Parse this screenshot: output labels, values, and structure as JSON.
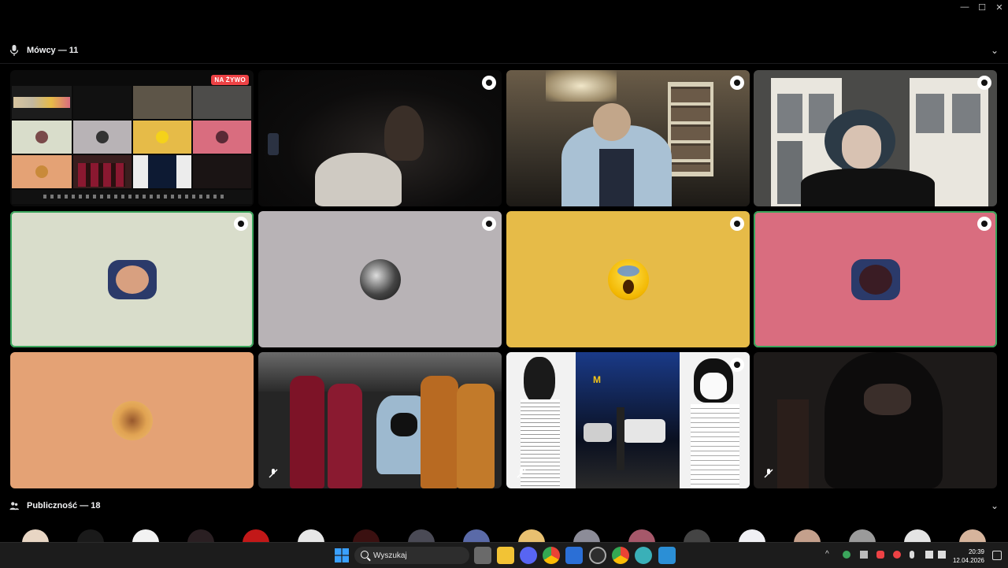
{
  "window": {
    "minimize": "—",
    "maximize": "☐",
    "close": "✕"
  },
  "speakers": {
    "label": "Mówcy — 11",
    "icon": "microphone-icon",
    "chevron": "⌄"
  },
  "audience": {
    "label": "Publiczność — 18",
    "icon": "people-icon",
    "chevron": "⌄"
  },
  "live_badge": "NA ŻYWO",
  "tiles": [
    {
      "name": "screen-share-tile",
      "kind": "stream"
    },
    {
      "name": "camera-tile-dark-room",
      "kind": "camera"
    },
    {
      "name": "camera-tile-bookshelf",
      "kind": "camera"
    },
    {
      "name": "camera-tile-window",
      "kind": "camera"
    },
    {
      "name": "avatar-tile-beige",
      "kind": "avatar",
      "bg": "#d9ddcb",
      "speaking": true
    },
    {
      "name": "avatar-tile-gray",
      "kind": "avatar",
      "bg": "#b8b3b6"
    },
    {
      "name": "avatar-tile-yellow",
      "kind": "avatar",
      "bg": "#e6bb48"
    },
    {
      "name": "avatar-tile-pink",
      "kind": "avatar",
      "bg": "#d96d7f",
      "speaking": true
    },
    {
      "name": "avatar-tile-orange",
      "kind": "avatar",
      "bg": "#e4a275"
    },
    {
      "name": "camera-tile-bottles",
      "kind": "camera"
    },
    {
      "name": "camera-tile-manga",
      "kind": "camera"
    },
    {
      "name": "camera-tile-masked",
      "kind": "camera"
    }
  ],
  "taskbar": {
    "search_placeholder": "Wyszukaj",
    "time": "20:39",
    "date": "12.04.2026"
  },
  "colors": {
    "background": "#000000",
    "speaking_ring": "#3ba55c",
    "live_red": "#ed4245",
    "taskbar": "#1c1c1c"
  }
}
